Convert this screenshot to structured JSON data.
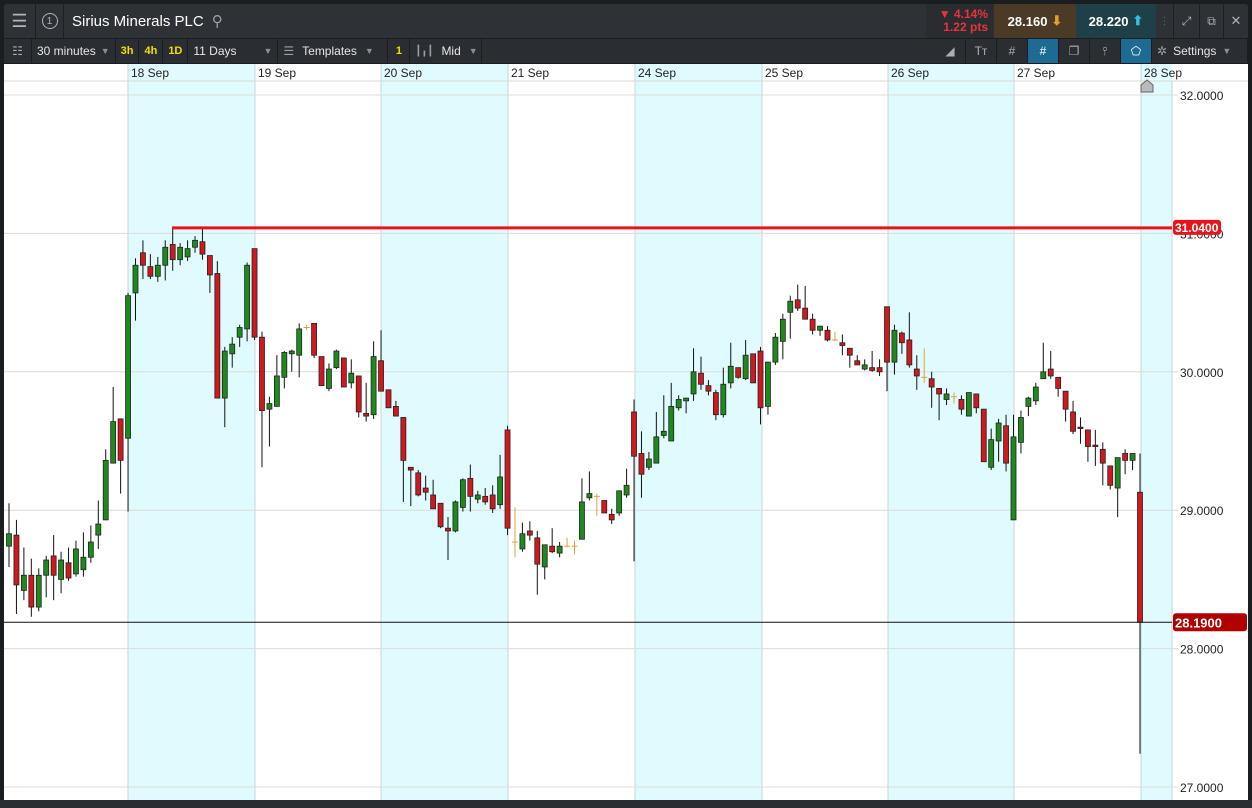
{
  "header": {
    "title": "Sirius Minerals PLC",
    "badge": "1",
    "change_pct": "▼ 4.14%",
    "change_pts": "1.22 pts",
    "sell": "28.160",
    "buy": "28.220"
  },
  "toolbar": {
    "interval": "30 minutes",
    "q1": "3h",
    "q2": "4h",
    "q3": "1D",
    "range": "11 Days",
    "templates": "Templates",
    "count": "1",
    "price_type": "Mid",
    "settings": "Settings"
  },
  "colors": {
    "up": "#1e8a1e",
    "down": "#d0181e",
    "doji": "#e0a040",
    "band": "#e0fbfd",
    "hline": "#e8141c",
    "current": "#b00000"
  },
  "chart_data": {
    "type": "candlestick",
    "xlabels": [
      "18 Sep",
      "19 Sep",
      "20 Sep",
      "21 Sep",
      "24 Sep",
      "25 Sep",
      "26 Sep",
      "27 Sep",
      "28 Sep"
    ],
    "yticks": [
      "32.0000",
      "31.0000",
      "30.0000",
      "29.0000",
      "28.0000",
      "27.0000"
    ],
    "ylim": [
      27,
      32
    ],
    "horizontal_line": {
      "value": 31.04,
      "label": "31.0400"
    },
    "current_price": {
      "value": 28.19,
      "label": "28.1900"
    },
    "ohlc": [
      [
        28.74,
        29.05,
        28.59,
        28.83
      ],
      [
        28.82,
        28.93,
        28.25,
        28.46
      ],
      [
        28.42,
        28.73,
        28.35,
        28.53
      ],
      [
        28.53,
        28.65,
        28.23,
        28.3
      ],
      [
        28.3,
        28.58,
        28.27,
        28.53
      ],
      [
        28.53,
        28.67,
        28.37,
        28.64
      ],
      [
        28.67,
        28.82,
        28.35,
        28.53
      ],
      [
        28.5,
        28.7,
        28.4,
        28.64
      ],
      [
        28.62,
        28.73,
        28.49,
        28.51
      ],
      [
        28.54,
        28.78,
        28.52,
        28.72
      ],
      [
        28.57,
        28.84,
        28.52,
        28.66
      ],
      [
        28.66,
        28.89,
        28.62,
        28.77
      ],
      [
        28.82,
        29.07,
        28.72,
        28.9
      ],
      [
        28.93,
        29.44,
        28.93,
        29.36
      ],
      [
        29.34,
        29.89,
        29.34,
        29.64
      ],
      [
        29.66,
        29.66,
        29.12,
        29.36
      ],
      [
        29.52,
        30.57,
        28.99,
        30.55
      ],
      [
        30.57,
        30.82,
        30.37,
        30.77
      ],
      [
        30.86,
        30.95,
        30.67,
        30.77
      ],
      [
        30.76,
        30.85,
        30.67,
        30.69
      ],
      [
        30.69,
        30.83,
        30.65,
        30.77
      ],
      [
        30.77,
        30.95,
        30.66,
        30.9
      ],
      [
        30.92,
        31.04,
        30.73,
        30.81
      ],
      [
        30.81,
        30.93,
        30.77,
        30.9
      ],
      [
        30.83,
        30.95,
        30.8,
        30.89
      ],
      [
        30.9,
        30.98,
        30.86,
        30.95
      ],
      [
        30.94,
        31.04,
        30.81,
        30.85
      ],
      [
        30.84,
        30.84,
        30.57,
        30.7
      ],
      [
        30.71,
        30.8,
        29.81,
        29.81
      ],
      [
        29.81,
        30.18,
        29.6,
        30.15
      ],
      [
        30.13,
        30.25,
        30.03,
        30.2
      ],
      [
        30.25,
        30.34,
        30.18,
        30.32
      ],
      [
        30.31,
        30.79,
        30.22,
        30.77
      ],
      [
        30.89,
        30.89,
        30.23,
        30.25
      ],
      [
        30.25,
        30.29,
        29.31,
        29.72
      ],
      [
        29.73,
        29.82,
        29.46,
        29.77
      ],
      [
        29.75,
        30.12,
        29.75,
        29.97
      ],
      [
        29.96,
        30.15,
        29.88,
        30.14
      ],
      [
        30.13,
        30.16,
        30.0,
        30.15
      ],
      [
        30.12,
        30.35,
        29.96,
        30.31
      ],
      [
        30.32,
        30.34,
        30.3,
        30.32
      ],
      [
        30.35,
        30.35,
        30.1,
        30.12
      ],
      [
        30.11,
        30.11,
        29.9,
        29.9
      ],
      [
        29.88,
        30.06,
        29.86,
        30.02
      ],
      [
        30.03,
        30.16,
        30.02,
        30.15
      ],
      [
        30.1,
        30.1,
        29.89,
        29.89
      ],
      [
        29.92,
        30.09,
        29.88,
        29.99
      ],
      [
        29.97,
        29.97,
        29.67,
        29.71
      ],
      [
        29.7,
        29.92,
        29.64,
        29.68
      ],
      [
        29.69,
        30.22,
        29.66,
        30.11
      ],
      [
        30.08,
        30.3,
        29.86,
        29.86
      ],
      [
        29.87,
        29.87,
        29.74,
        29.74
      ],
      [
        29.75,
        29.79,
        29.68,
        29.68
      ],
      [
        29.67,
        29.67,
        29.06,
        29.36
      ],
      [
        29.31,
        29.31,
        29.03,
        29.29
      ],
      [
        29.27,
        29.29,
        29.1,
        29.11
      ],
      [
        29.16,
        29.25,
        29.07,
        29.13
      ],
      [
        29.11,
        29.22,
        29.01,
        29.01
      ],
      [
        29.05,
        29.05,
        28.87,
        28.88
      ],
      [
        28.87,
        28.95,
        28.64,
        28.85
      ],
      [
        28.85,
        29.07,
        28.84,
        29.06
      ],
      [
        29.02,
        29.23,
        28.99,
        29.22
      ],
      [
        29.23,
        29.33,
        28.99,
        29.1
      ],
      [
        29.08,
        29.14,
        29.05,
        29.11
      ],
      [
        29.1,
        29.16,
        29.04,
        29.06
      ],
      [
        29.11,
        29.18,
        28.98,
        29.01
      ],
      [
        29.04,
        29.4,
        29.01,
        29.24
      ],
      [
        29.58,
        29.61,
        28.82,
        28.87
      ],
      [
        28.77,
        29.02,
        28.66,
        28.77
      ],
      [
        28.72,
        28.91,
        28.7,
        28.83
      ],
      [
        28.85,
        28.92,
        28.78,
        28.82
      ],
      [
        28.8,
        28.85,
        28.39,
        28.61
      ],
      [
        28.59,
        28.75,
        28.5,
        28.75
      ],
      [
        28.74,
        28.87,
        28.69,
        28.7
      ],
      [
        28.69,
        28.77,
        28.66,
        28.74
      ],
      [
        28.74,
        28.8,
        28.73,
        28.74
      ],
      [
        28.74,
        28.78,
        28.68,
        28.74
      ],
      [
        28.79,
        29.23,
        28.79,
        29.06
      ],
      [
        29.09,
        29.28,
        29.07,
        29.12
      ],
      [
        29.1,
        29.12,
        28.96,
        29.1
      ],
      [
        29.07,
        29.07,
        28.98,
        28.98
      ],
      [
        28.97,
        29.01,
        28.9,
        28.93
      ],
      [
        28.98,
        29.14,
        28.96,
        29.14
      ],
      [
        29.11,
        29.3,
        29.09,
        29.18
      ],
      [
        29.71,
        29.8,
        28.63,
        29.39
      ],
      [
        29.41,
        29.57,
        29.09,
        29.26
      ],
      [
        29.31,
        29.42,
        29.29,
        29.37
      ],
      [
        29.34,
        29.71,
        29.34,
        29.53
      ],
      [
        29.54,
        29.83,
        29.52,
        29.57
      ],
      [
        29.5,
        29.92,
        29.5,
        29.75
      ],
      [
        29.74,
        29.83,
        29.72,
        29.8
      ],
      [
        29.79,
        29.81,
        29.7,
        29.81
      ],
      [
        29.84,
        30.17,
        29.79,
        30.0
      ],
      [
        29.99,
        30.11,
        29.87,
        29.91
      ],
      [
        29.9,
        29.94,
        29.83,
        29.86
      ],
      [
        29.85,
        29.87,
        29.65,
        29.69
      ],
      [
        29.69,
        30.03,
        29.67,
        29.91
      ],
      [
        29.92,
        30.21,
        29.88,
        30.04
      ],
      [
        30.03,
        30.03,
        29.95,
        29.96
      ],
      [
        29.95,
        30.23,
        29.94,
        30.12
      ],
      [
        30.13,
        30.13,
        29.92,
        29.92
      ],
      [
        30.15,
        30.18,
        29.62,
        29.74
      ],
      [
        29.75,
        30.07,
        29.69,
        30.07
      ],
      [
        30.07,
        30.28,
        30.05,
        30.25
      ],
      [
        30.22,
        30.42,
        30.09,
        30.38
      ],
      [
        30.43,
        30.55,
        30.24,
        30.51
      ],
      [
        30.52,
        30.63,
        30.44,
        30.46
      ],
      [
        30.46,
        30.62,
        30.38,
        30.38
      ],
      [
        30.38,
        30.42,
        30.27,
        30.3
      ],
      [
        30.3,
        30.33,
        30.26,
        30.33
      ],
      [
        30.3,
        30.33,
        30.22,
        30.23
      ],
      [
        30.23,
        30.29,
        30.22,
        30.23
      ],
      [
        30.21,
        30.27,
        30.12,
        30.19
      ],
      [
        30.17,
        30.17,
        30.03,
        30.12
      ],
      [
        30.08,
        30.12,
        30.05,
        30.05
      ],
      [
        30.02,
        30.09,
        30.01,
        30.05
      ],
      [
        30.03,
        30.15,
        30.0,
        30.01
      ],
      [
        30.03,
        30.09,
        29.97,
        30.0
      ],
      [
        30.47,
        30.47,
        29.86,
        30.07
      ],
      [
        30.07,
        30.34,
        29.98,
        30.3
      ],
      [
        30.28,
        30.29,
        30.13,
        30.21
      ],
      [
        30.23,
        30.43,
        30.03,
        30.05
      ],
      [
        30.02,
        30.12,
        29.87,
        29.97
      ],
      [
        29.96,
        30.17,
        29.92,
        29.96
      ],
      [
        29.95,
        30.0,
        29.74,
        29.89
      ],
      [
        29.88,
        29.88,
        29.65,
        29.84
      ],
      [
        29.8,
        29.88,
        29.76,
        29.84
      ],
      [
        29.82,
        29.85,
        29.77,
        29.82
      ],
      [
        29.8,
        29.83,
        29.69,
        29.73
      ],
      [
        29.68,
        29.85,
        29.68,
        29.85
      ],
      [
        29.84,
        29.84,
        29.7,
        29.74
      ],
      [
        29.73,
        29.73,
        29.35,
        29.35
      ],
      [
        29.31,
        29.59,
        29.29,
        29.51
      ],
      [
        29.5,
        29.66,
        29.35,
        29.63
      ],
      [
        29.61,
        29.69,
        29.28,
        29.34
      ],
      [
        28.93,
        29.69,
        28.93,
        29.53
      ],
      [
        29.49,
        29.72,
        29.41,
        29.67
      ],
      [
        29.75,
        29.82,
        29.68,
        29.81
      ],
      [
        29.79,
        29.92,
        29.76,
        29.89
      ],
      [
        29.95,
        30.21,
        29.95,
        30.0
      ],
      [
        30.02,
        30.15,
        29.95,
        29.97
      ],
      [
        29.96,
        29.96,
        29.82,
        29.88
      ],
      [
        29.86,
        29.86,
        29.64,
        29.73
      ],
      [
        29.71,
        29.79,
        29.55,
        29.57
      ],
      [
        29.6,
        29.67,
        29.48,
        29.59
      ],
      [
        29.58,
        29.58,
        29.35,
        29.46
      ],
      [
        29.47,
        29.58,
        29.32,
        29.46
      ],
      [
        29.44,
        29.49,
        29.18,
        29.34
      ],
      [
        29.32,
        29.32,
        29.15,
        29.18
      ],
      [
        29.16,
        29.38,
        28.95,
        29.38
      ],
      [
        29.41,
        29.44,
        29.26,
        29.36
      ],
      [
        29.36,
        29.41,
        29.29,
        29.41
      ],
      [
        29.13,
        29.41,
        27.24,
        28.19
      ]
    ]
  }
}
